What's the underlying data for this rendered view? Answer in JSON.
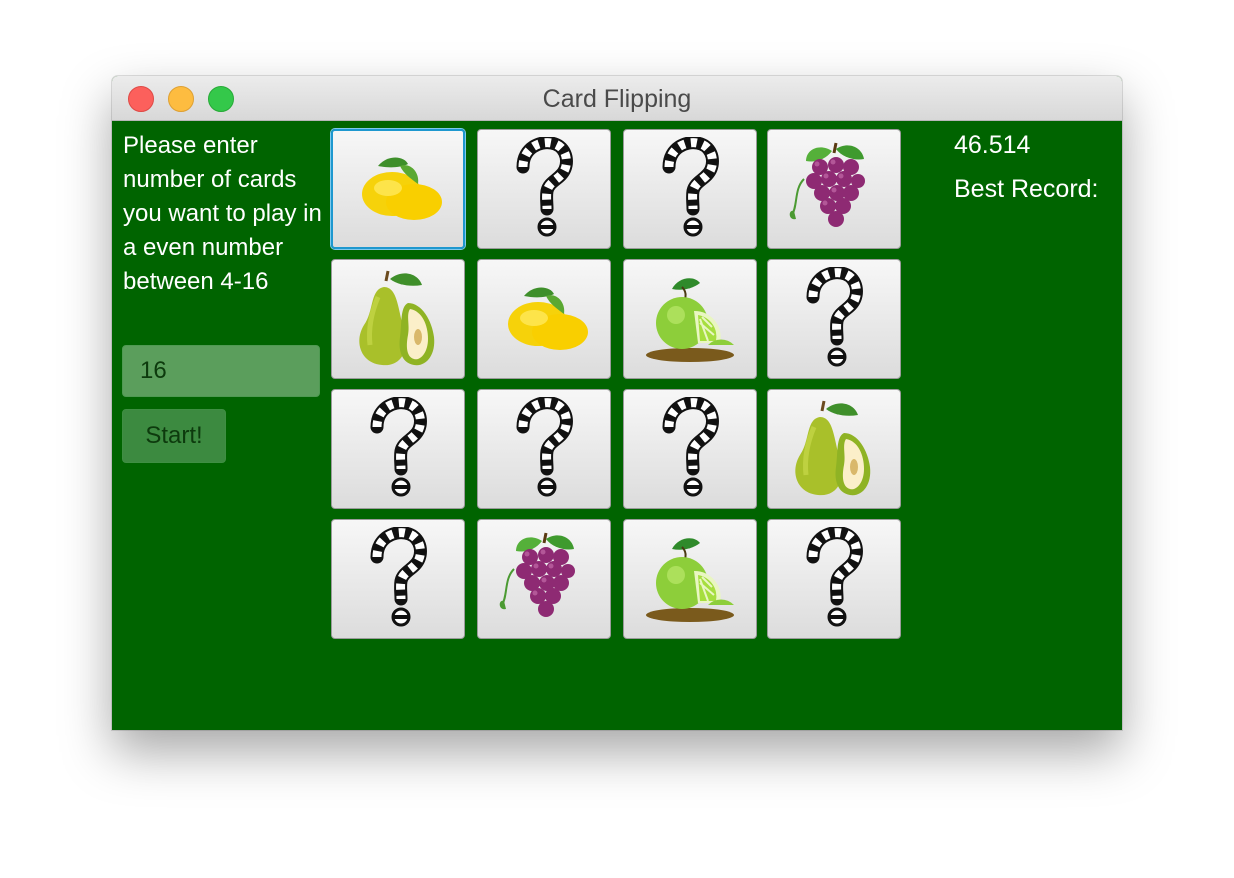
{
  "window": {
    "title": "Card Flipping",
    "controls": [
      "close",
      "minimize",
      "zoom"
    ]
  },
  "sidebar": {
    "prompt": "Please enter number of cards you want to play in a even number between 4-16",
    "count_value": "16",
    "start_label": "Start!"
  },
  "stats": {
    "timer": "46.514",
    "best_label": "Best Record:"
  },
  "colors": {
    "background": "#006400",
    "focus": "#1e98cf"
  },
  "cards": [
    {
      "face": "lemon",
      "focused": true
    },
    {
      "face": "question-mark"
    },
    {
      "face": "question-mark"
    },
    {
      "face": "grapes"
    },
    {
      "face": "pear"
    },
    {
      "face": "lemon"
    },
    {
      "face": "lime"
    },
    {
      "face": "question-mark"
    },
    {
      "face": "question-mark"
    },
    {
      "face": "question-mark"
    },
    {
      "face": "question-mark"
    },
    {
      "face": "pear"
    },
    {
      "face": "question-mark"
    },
    {
      "face": "grapes"
    },
    {
      "face": "lime"
    },
    {
      "face": "question-mark"
    }
  ]
}
